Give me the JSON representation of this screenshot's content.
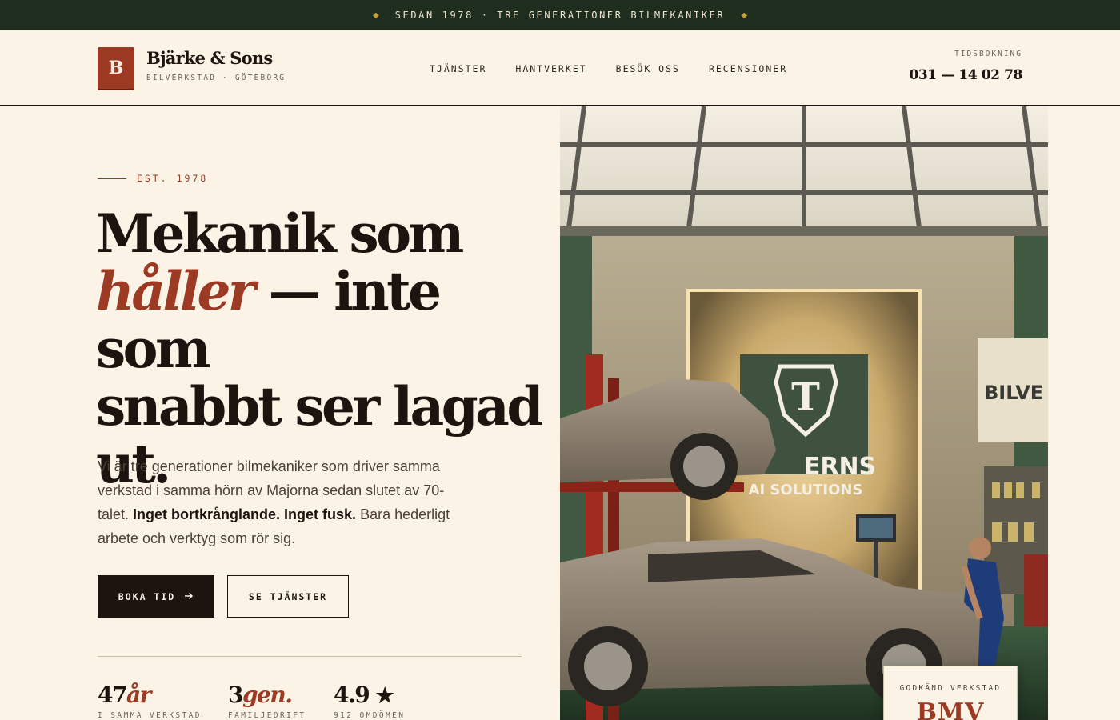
{
  "topbar": {
    "message": "SEDAN 1978 · TRE GENERATIONER BILMEKANIKER"
  },
  "brand": {
    "initial": "B",
    "name": "Bjärke & Sons",
    "subtitle": "BILVERKSTAD · GÖTEBORG"
  },
  "nav": {
    "items": [
      {
        "label": "TJÄNSTER"
      },
      {
        "label": "HANTVERKET"
      },
      {
        "label": "BESÖK OSS"
      },
      {
        "label": "RECENSIONER"
      }
    ]
  },
  "booking": {
    "label": "TIDSBOKNING",
    "phone": "031 — 14 02 78"
  },
  "hero": {
    "eyebrow": "EST. 1978",
    "headline": {
      "line1": "Mekanik som",
      "highlight": "håller",
      "line2_rest": " — inte som",
      "line3": "snabbt ser lagad",
      "line4": "ut."
    },
    "lede": {
      "part1": "Vi är tre generationer bilmekaniker som driver samma verkstad i samma hörn av Majorna sedan slutet av 70-talet. ",
      "bold": "Inget bortkrånglande. Inget fusk.",
      "part2": " Bara hederligt arbete och verktyg som rör sig."
    },
    "primary_button": "BOKA TID",
    "secondary_button": "SE TJÄNSTER"
  },
  "stats": [
    {
      "value": "47",
      "accent": "år",
      "label": "I SAMMA VERKSTAD"
    },
    {
      "value": "3",
      "accent": "gen.",
      "label": "FAMILJEDRIFT"
    },
    {
      "value": "4.9",
      "accent": "★",
      "label": "912 OMDÖMEN"
    }
  ],
  "image": {
    "sign_letter": "T",
    "sign_text": "ERNS",
    "sign_subtext": "AI SOLUTIONS",
    "side_sign": "BILVE"
  },
  "badge": {
    "label": "GODKÄND VERKSTAD",
    "value": "BMV"
  },
  "colors": {
    "accent": "#9c3a24",
    "dark": "#1c140e",
    "topbar": "#1f2d1e",
    "background": "#faf3e6"
  }
}
